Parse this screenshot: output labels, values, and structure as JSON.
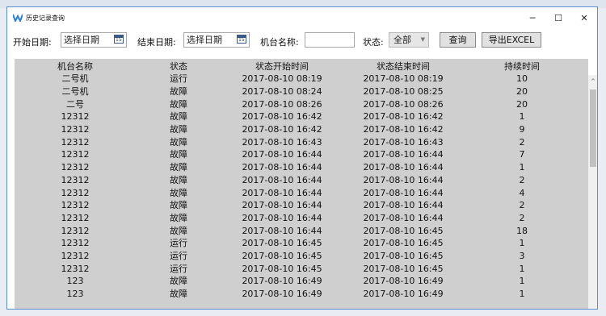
{
  "window": {
    "title": "历史记录查询",
    "minimize_symbol": "─",
    "maximize_symbol": "☐",
    "close_symbol": "✕"
  },
  "filters": {
    "start_date_label": "开始日期:",
    "start_date_value": "选择日期",
    "end_date_label": "结束日期:",
    "end_date_value": "选择日期",
    "calendar_icon_text": "15",
    "machine_name_label": "机台名称:",
    "machine_name_value": "",
    "status_label": "状态:",
    "status_selected": "全部",
    "query_button": "查询",
    "export_button": "导出EXCEL"
  },
  "table": {
    "columns": [
      "机台名称",
      "状态",
      "状态开始时间",
      "状态结束时间",
      "持续时间"
    ],
    "rows": [
      [
        "二号机",
        "运行",
        "2017-08-10 08:19",
        "2017-08-10 08:19",
        "10"
      ],
      [
        "二号机",
        "故障",
        "2017-08-10 08:24",
        "2017-08-10 08:25",
        "20"
      ],
      [
        "二号",
        "故障",
        "2017-08-10 08:26",
        "2017-08-10 08:26",
        "20"
      ],
      [
        "12312",
        "故障",
        "2017-08-10 16:42",
        "2017-08-10 16:42",
        "1"
      ],
      [
        "12312",
        "故障",
        "2017-08-10 16:42",
        "2017-08-10 16:42",
        "9"
      ],
      [
        "12312",
        "故障",
        "2017-08-10 16:43",
        "2017-08-10 16:43",
        "2"
      ],
      [
        "12312",
        "故障",
        "2017-08-10 16:44",
        "2017-08-10 16:44",
        "7"
      ],
      [
        "12312",
        "故障",
        "2017-08-10 16:44",
        "2017-08-10 16:44",
        "1"
      ],
      [
        "12312",
        "故障",
        "2017-08-10 16:44",
        "2017-08-10 16:44",
        "2"
      ],
      [
        "12312",
        "故障",
        "2017-08-10 16:44",
        "2017-08-10 16:44",
        "4"
      ],
      [
        "12312",
        "故障",
        "2017-08-10 16:44",
        "2017-08-10 16:44",
        "2"
      ],
      [
        "12312",
        "故障",
        "2017-08-10 16:44",
        "2017-08-10 16:44",
        "2"
      ],
      [
        "12312",
        "故障",
        "2017-08-10 16:44",
        "2017-08-10 16:45",
        "18"
      ],
      [
        "12312",
        "运行",
        "2017-08-10 16:45",
        "2017-08-10 16:45",
        "1"
      ],
      [
        "12312",
        "运行",
        "2017-08-10 16:45",
        "2017-08-10 16:45",
        "3"
      ],
      [
        "12312",
        "运行",
        "2017-08-10 16:45",
        "2017-08-10 16:45",
        "1"
      ],
      [
        "123",
        "故障",
        "2017-08-10 16:49",
        "2017-08-10 16:49",
        "1"
      ],
      [
        "123",
        "故障",
        "2017-08-10 16:49",
        "2017-08-10 16:49",
        "1"
      ]
    ]
  },
  "scrollbar": {
    "up_arrow": "^"
  },
  "colors": {
    "grid_background": "#cfcfcf",
    "window_border": "#5a8fd6",
    "button_background": "#e1e1e1"
  }
}
